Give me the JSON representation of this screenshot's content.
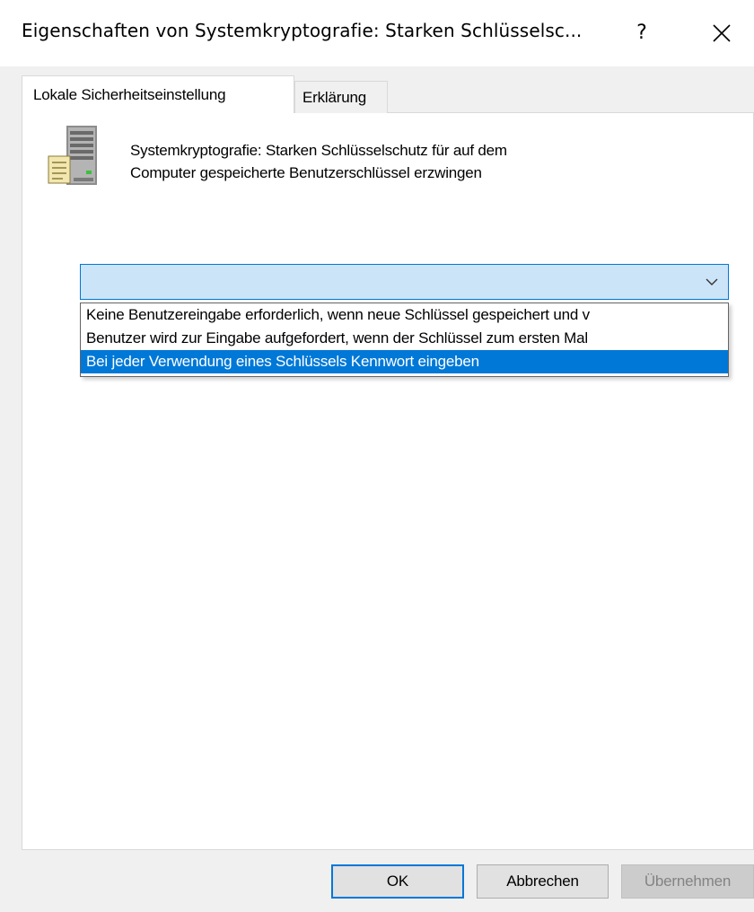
{
  "window": {
    "title": "Eigenschaften von Systemkryptografie: Starken Schlüsselsc...",
    "help_label": "?",
    "close_label": "✕"
  },
  "tabs": [
    {
      "label": "Lokale Sicherheitseinstellung",
      "active": true
    },
    {
      "label": "Erklärung",
      "active": false
    }
  ],
  "policy": {
    "icon": "server-policy-icon",
    "description_line1": "Systemkryptografie: Starken Schlüsselschutz für auf dem",
    "description_line2": "Computer gespeicherte Benutzerschlüssel erzwingen"
  },
  "combo": {
    "value": "",
    "arrow_icon": "chevron-down-icon",
    "options": [
      "Keine Benutzereingabe erforderlich, wenn neue Schlüssel gespeichert und v",
      "Benutzer wird zur Eingabe aufgefordert, wenn der Schlüssel zum ersten Mal",
      "Bei jeder Verwendung eines Schlüssels Kennwort eingeben"
    ],
    "highlighted_index": 2
  },
  "buttons": {
    "ok": "OK",
    "cancel": "Abbrechen",
    "apply": "Übernehmen"
  },
  "colors": {
    "accent": "#0078d7",
    "combo_bg": "#cce4f7"
  }
}
